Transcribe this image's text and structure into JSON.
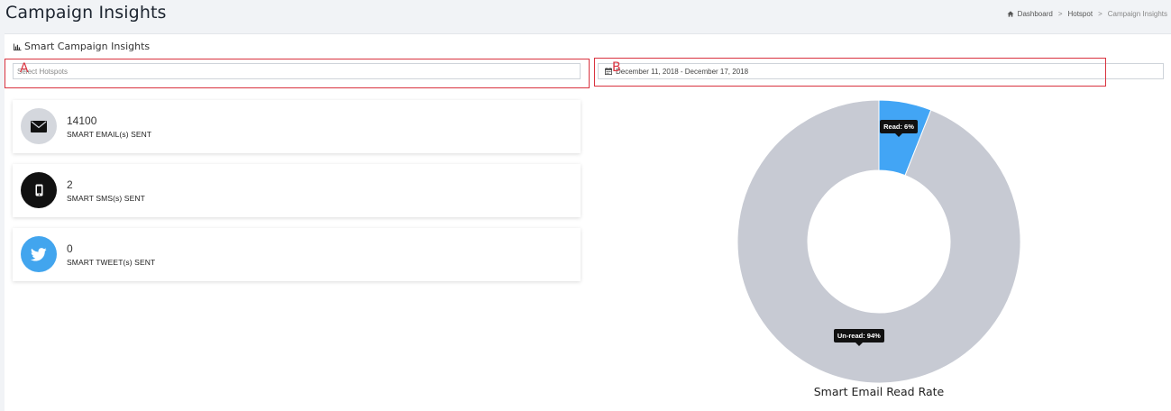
{
  "header": {
    "title": "Campaign Insights",
    "breadcrumb": [
      "Dashboard",
      "Hotspot",
      "Campaign Insights"
    ],
    "breadcrumb_separator": ">"
  },
  "panel": {
    "heading": "Smart Campaign Insights",
    "annotations": {
      "a": "A",
      "b": "B"
    },
    "hotspot_select": {
      "placeholder": "Select Hotspots",
      "value": ""
    },
    "date_range": "December 11, 2018 - December 17, 2018"
  },
  "stats": [
    {
      "value": "14100",
      "label": "SMART EMAIL(s) SENT",
      "icon": "envelope-icon",
      "color": "#d4d7dd"
    },
    {
      "value": "2",
      "label": "SMART SMS(s) SENT",
      "icon": "mobile-phone-icon",
      "color": "#111111"
    },
    {
      "value": "0",
      "label": "SMART TWEET(s) SENT",
      "icon": "twitter-bird-icon",
      "color": "#42a5ee"
    }
  ],
  "chart_data": {
    "type": "pie",
    "title": "Smart Email Read Rate",
    "categories": [
      "Read",
      "Un-read"
    ],
    "values": [
      6,
      94
    ],
    "tooltips": [
      "Read: 6%",
      "Un-read: 94%"
    ],
    "colors": [
      "#42a5f5",
      "#c7cad3"
    ]
  }
}
